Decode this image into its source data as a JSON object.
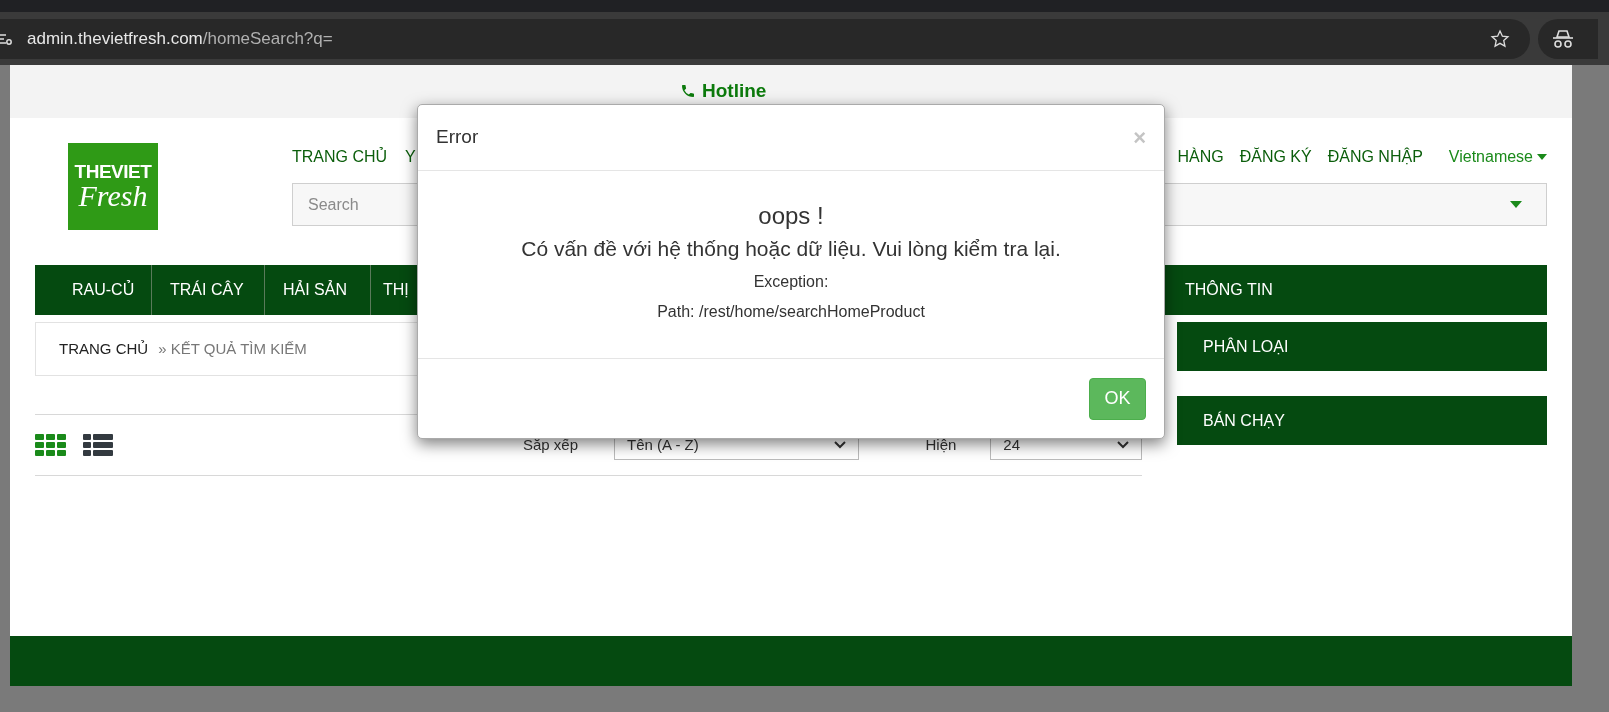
{
  "browser": {
    "url_host": "admin.thevietfresh.com",
    "url_path": "/homeSearch?q="
  },
  "hotline": "Hotline",
  "logo": {
    "line1": "THEVIET",
    "line2": "Fresh"
  },
  "nav_left": [
    "TRANG CHỦ",
    "Y"
  ],
  "nav_right": [
    "HÀNG",
    "ĐĂNG KÝ",
    "ĐĂNG NHẬP"
  ],
  "language": "Vietnamese",
  "search": {
    "placeholder": "Search"
  },
  "categories": [
    "RAU-CỦ",
    "TRÁI CÂY",
    "HẢI SẢN",
    "THỊ"
  ],
  "categories_right": "THÔNG TIN",
  "breadcrumb": {
    "home": "TRANG CHỦ",
    "current": "» KẾT QUẢ TÌM KIẾM"
  },
  "view_modes": [
    {
      "kind": "grid",
      "selected": true
    },
    {
      "kind": "list",
      "selected": false
    }
  ],
  "sort": {
    "label": "Sắp xếp",
    "value": "Tên (A - Z)"
  },
  "show": {
    "label": "Hiện",
    "value": "24"
  },
  "sidebar": [
    "PHÂN LOẠI",
    "BÁN CHẠY"
  ],
  "dialog": {
    "title": "Error",
    "close": "×",
    "heading": "oops !",
    "message": "Có vấn đề với hệ thống hoặc dữ liệu. Vui lòng kiểm tra lại.",
    "exception": "Exception:",
    "path": "Path: /rest/home/searchHomeProduct",
    "ok": "OK"
  }
}
